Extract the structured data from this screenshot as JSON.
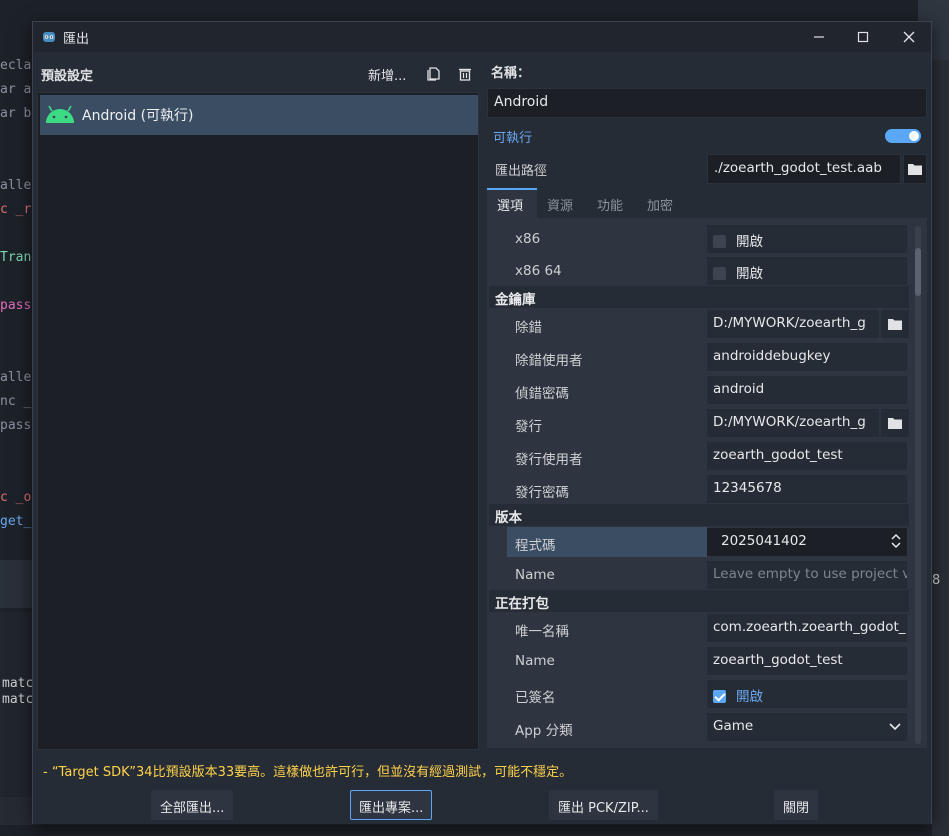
{
  "background": {
    "code_fragments": [
      "eclar",
      "ar a",
      "ar b",
      "alle",
      "c _re",
      "Tran",
      "pass",
      "alle",
      "nc _p",
      "pass",
      "c _on",
      "get_",
      "matc",
      "matc"
    ],
    "status_number": "8"
  },
  "window": {
    "title": "匯出",
    "minimize_label": "—",
    "maximize_label": "☐",
    "close_label": "✕"
  },
  "presets": {
    "title": "預設設定",
    "add_label": "新增...",
    "items": [
      {
        "label": "Android (可執行)",
        "icon": "android-icon",
        "selected": true
      }
    ]
  },
  "detail": {
    "name_label": "名稱：",
    "name_value": "Android",
    "runnable_label": "可執行",
    "runnable_on": true,
    "export_path_label": "匯出路徑",
    "export_path_value": "./zoearth_godot_test.aab",
    "tabs": [
      "選項",
      "資源",
      "功能",
      "加密"
    ],
    "active_tab": 0
  },
  "options": {
    "x86": {
      "label": "x86",
      "value": "開啟",
      "checked": false
    },
    "x86_64": {
      "label": "x86 64",
      "value": "開啟",
      "checked": false
    },
    "keystore_section": "金鑰庫",
    "debug": {
      "label": "除錯",
      "value": "D:/MYWORK/zoearth_g"
    },
    "debug_user": {
      "label": "除錯使用者",
      "value": "androiddebugkey"
    },
    "debug_password": {
      "label": "偵錯密碼",
      "value": "android"
    },
    "release": {
      "label": "發行",
      "value": "D:/MYWORK/zoearth_g"
    },
    "release_user": {
      "label": "發行使用者",
      "value": "zoearth_godot_test"
    },
    "release_password": {
      "label": "發行密碼",
      "value": "12345678"
    },
    "version_section": "版本",
    "version_code": {
      "label": "程式碼",
      "value": "2025041402"
    },
    "version_name": {
      "label": "Name",
      "placeholder": "Leave empty to use project v"
    },
    "packaging_section": "正在打包",
    "unique_name": {
      "label": "唯一名稱",
      "value": "com.zoearth.zoearth_godot_"
    },
    "package_name": {
      "label": "Name",
      "value": "zoearth_godot_test"
    },
    "signed": {
      "label": "已簽名",
      "value": "開啟",
      "checked": true
    },
    "app_category": {
      "label": "App 分類",
      "value": "Game"
    }
  },
  "warning": "- “Target SDK”34比預設版本33要高。這樣做也許可行，但並沒有經過測試，可能不穩定。",
  "footer": {
    "export_all": "全部匯出...",
    "export_project": "匯出專案...",
    "export_pck": "匯出 PCK/ZIP...",
    "close": "關閉"
  },
  "colors": {
    "accent": "#5aa8f5",
    "warning": "#ffd24a",
    "selected_row": "#3b4d63",
    "android_green": "#3ddc84"
  }
}
